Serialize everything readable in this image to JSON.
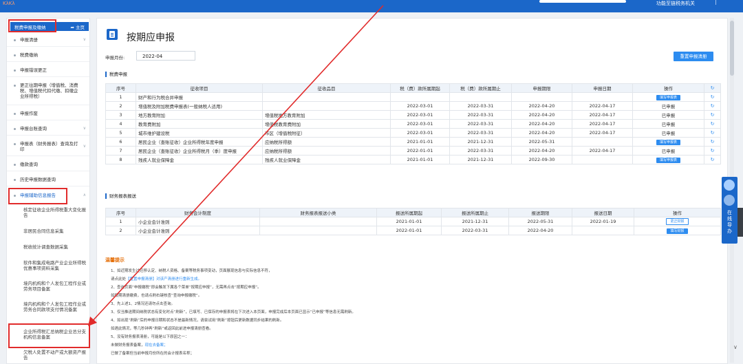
{
  "topbar": {
    "brand": "ΚλΚλ",
    "user": "功能至链税务机关"
  },
  "sidebar": {
    "head_title": "税费申报及缴纳",
    "home_label": "主页",
    "items": [
      {
        "label": "申报清册",
        "chevron": true
      },
      {
        "label": "税费缴纳",
        "chevron": false
      },
      {
        "label": "申报错误更正",
        "chevron": false
      },
      {
        "label": "更正往期申报（增值税、消费税、增值税代扣代缴、扣缴企业所得税）",
        "chevron": false
      },
      {
        "label": "申报作废",
        "chevron": false
      },
      {
        "label": "申报台账查询",
        "chevron": true
      },
      {
        "label": "申报表（财务报表）查询及打印",
        "chevron": true
      },
      {
        "label": "缴款查询",
        "chevron": false
      },
      {
        "label": "历史申报数据查询",
        "chevron": false
      },
      {
        "label": "申报辅助信息报告",
        "chevron": true
      }
    ],
    "subitems": [
      "核定征收企业所得税重大变化报告",
      "非居民合同信息采集",
      "税收统计调查数据采集",
      "软件和集成电路产业企业所得税优惠事项资料采集",
      "境内机构和个人发包工程作业或劳务项目备案",
      "境内机构和个人发包工程作业或劳务合同款项支付情况备案",
      "企业所得税汇总纳税企业总分支机构信息备案",
      "欠税人处置不动产或大额资产报告"
    ]
  },
  "main": {
    "title": "按期应申报",
    "month_label": "申报月份:",
    "month_value": "2022-04",
    "reset_label": "重置申报清册",
    "tax_section": "税费申报",
    "tax_headers": [
      "序号",
      "征收项目",
      "征收品目",
      "税（费）款所属期起",
      "税（费）款所属期止",
      "申报期限",
      "申报日期",
      "操作"
    ],
    "tax_rows": [
      {
        "no": "1",
        "item": "财产和行为税合并申报",
        "sub": "",
        "start": "",
        "end": "",
        "deadline": "",
        "date": "",
        "op": "填写申报表",
        "op_type": "button"
      },
      {
        "no": "2",
        "item": "增值税及附加税费申报表(一般纳税人适用)",
        "sub": "",
        "start": "2022-03-01",
        "end": "2022-03-31",
        "deadline": "2022-04-20",
        "date": "2022-04-17",
        "op": "已申报",
        "op_type": "text"
      },
      {
        "no": "3",
        "item": "地方教育附加",
        "sub": "增值税地方教育附加",
        "start": "2022-03-01",
        "end": "2022-03-31",
        "deadline": "2022-04-20",
        "date": "2022-04-17",
        "op": "已申报",
        "op_type": "text"
      },
      {
        "no": "4",
        "item": "教育费附加",
        "sub": "增值税教育费附加",
        "start": "2022-03-01",
        "end": "2022-03-31",
        "deadline": "2022-04-20",
        "date": "2022-04-17",
        "op": "已申报",
        "op_type": "text"
      },
      {
        "no": "5",
        "item": "城市维护建设税",
        "sub": "市区（增值税附征）",
        "start": "2022-03-01",
        "end": "2022-03-31",
        "deadline": "2022-04-20",
        "date": "2022-04-17",
        "op": "已申报",
        "op_type": "text"
      },
      {
        "no": "6",
        "item": "居民企业（查账征收）企业所得税年度申报",
        "sub": "应纳税所得额",
        "start": "2021-01-01",
        "end": "2021-12-31",
        "deadline": "2022-05-31",
        "date": "",
        "op": "填写申报表",
        "op_type": "button"
      },
      {
        "no": "7",
        "item": "居民企业（查账征收）企业所得税月（季）度申报",
        "sub": "应纳税所得额",
        "start": "2022-01-01",
        "end": "2022-03-31",
        "deadline": "2022-04-20",
        "date": "2022-04-17",
        "op": "已申报",
        "op_type": "text"
      },
      {
        "no": "8",
        "item": "残疾人就业保障金",
        "sub": "残疾人就业保障金",
        "start": "2021-01-01",
        "end": "2021-12-31",
        "deadline": "2022-09-30",
        "date": "",
        "op": "填写申报表",
        "op_type": "button"
      }
    ],
    "fin_section": "财务报表报送",
    "fin_headers": [
      "序号",
      "财务会计制度",
      "财务报表报送小类",
      "报送所属期起",
      "报送所属期止",
      "报送期限",
      "报送日期",
      "操作"
    ],
    "fin_rows": [
      {
        "no": "1",
        "system": "小企业会计准则",
        "type": "",
        "start": "2021-01-01",
        "end": "2021-12-31",
        "deadline": "2022-05-31",
        "date": "2022-01-19",
        "op": "更正财报",
        "op_type": "outline"
      },
      {
        "no": "2",
        "system": "小企业会计准则",
        "type": "",
        "start": "2022-01-01",
        "end": "2022-03-31",
        "deadline": "2022-04-20",
        "date": "",
        "op": "填写财报",
        "op_type": "button"
      }
    ],
    "notes_title": "温馨提示",
    "notes": [
      {
        "text": "1、如近期发生过迁移认定、纳税人资格、备案等税务事项变动，页面展现信息与实际信息不符，",
        "link": ""
      },
      {
        "text": "请点此处",
        "link": "【重置申报清册】对该产清册进行重新生成。"
      },
      {
        "text": "2、查询页面“申报缴税”即会触发下属各个菜单“按期应申报”，无需再点击“按期应申报”。",
        "link": ""
      },
      {
        "text": "如按期清册缴费，也请点刷右键核查“查询申报缴税”。",
        "link": ""
      },
      {
        "text": "3、先上述1、2情况还请勿点击查询。",
        "link": ""
      },
      {
        "text": "3、仅当推送期间纳税状态有变化时点“刷新”，已填写、已保存的申报表将在下次进入本页面，申报完成后本页面已显示“已申报”等信息无需刷新。",
        "link": ""
      },
      {
        "text": "4、如出现“刷新”后的申报日期和状态不是最新情况，请尝试用“刷新”按钮后更新数据同步结果的刷新。",
        "link": ""
      },
      {
        "text": "如遇此情况，等几秒钟再“刷新”或返回此前进申报清册查看。",
        "link": ""
      },
      {
        "text": "5、没有财务报表清册，可能是以下原因之一：",
        "link": ""
      },
      {
        "text": "未做财务报表备案，",
        "link": "现在去备案；"
      },
      {
        "text": "已做了备案但当前申报月份所在的会计报表名称；",
        "link": ""
      }
    ]
  },
  "float_panel": {
    "label": "在线导办"
  }
}
